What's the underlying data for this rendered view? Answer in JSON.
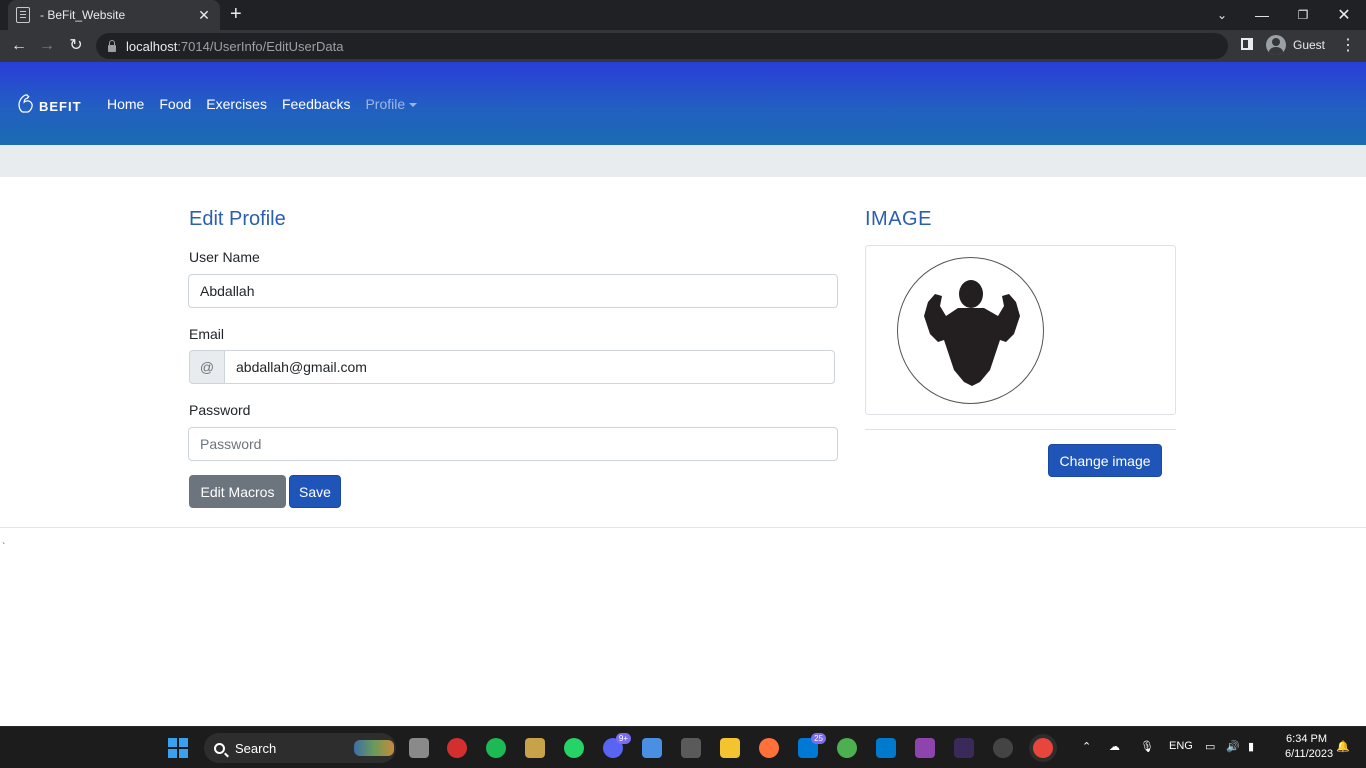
{
  "browser": {
    "tab_title": "- BeFit_Website",
    "new_tab": "+",
    "url_host": "localhost",
    "url_path": ":7014/UserInfo/EditUserData",
    "profile_label": "Guest"
  },
  "navbar": {
    "brand": "BEFIT",
    "links": [
      "Home",
      "Food",
      "Exercises",
      "Feedbacks"
    ],
    "profile_dropdown": "Profile"
  },
  "form": {
    "heading": "Edit Profile",
    "username_label": "User Name",
    "username_value": "Abdallah",
    "email_label": "Email",
    "email_addon": "@",
    "email_value": "abdallah@gmail.com",
    "password_label": "Password",
    "password_placeholder": "Password",
    "edit_macros_button": "Edit Macros",
    "save_button": "Save"
  },
  "image_panel": {
    "heading": "IMAGE",
    "change_button": "Change image"
  },
  "stray_mark": "`",
  "taskbar": {
    "search_label": "Search",
    "discord_badge": "9+",
    "mail_badge": "25",
    "language": "ENG",
    "time": "6:34 PM",
    "date": "6/11/2023"
  },
  "colors": {
    "navbar_top": "#2a3ed8",
    "navbar_bottom": "#1a6bb0",
    "primary_button": "#1f55b8",
    "secondary_button": "#6c757d",
    "heading_blue": "#2b5fb0"
  }
}
